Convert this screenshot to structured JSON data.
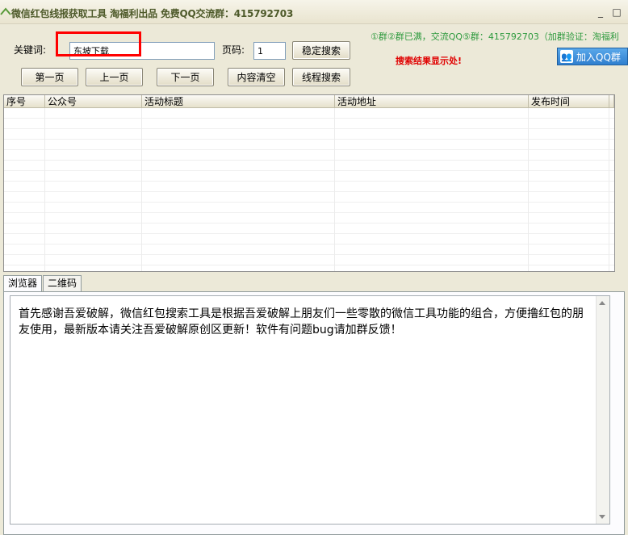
{
  "window": {
    "title": "微信红包线报获取工具 淘福利出品 免费QQ交流群：415792703",
    "minimize": "_",
    "maximize": "□"
  },
  "search": {
    "keyword_label": "关键词:",
    "keyword_value": "东坡下载",
    "page_label": "页码:",
    "page_value": "1",
    "stable_search": "稳定搜索",
    "thread_search": "线程搜索"
  },
  "nav": {
    "first": "第一页",
    "prev": "上一页",
    "next": "下一页",
    "clear": "内容清空"
  },
  "notice": "①群②群已满，交流QQ⑤群：415792703（加群验证：淘福利",
  "result_hint": "搜索结果显示处!",
  "qq_button": "加入QQ群",
  "table": {
    "columns": [
      "序号",
      "公众号",
      "活动标题",
      "活动地址",
      "发布时间"
    ]
  },
  "tabs": [
    "浏览器",
    "二维码"
  ],
  "browser": {
    "text": "首先感谢吾爱破解，微信红包搜索工具是根据吾爱破解上朋友们一些零散的微信工具功能的组合，方便撸红包的朋友使用，最新版本请关注吾爱破解原创区更新！软件有问题bug请加群反馈！"
  },
  "colors": {
    "notice": "#2e9a3e",
    "result_hint": "#e00000",
    "highlight_box": "#ff0000",
    "qq_button": "#2f7fcf"
  }
}
